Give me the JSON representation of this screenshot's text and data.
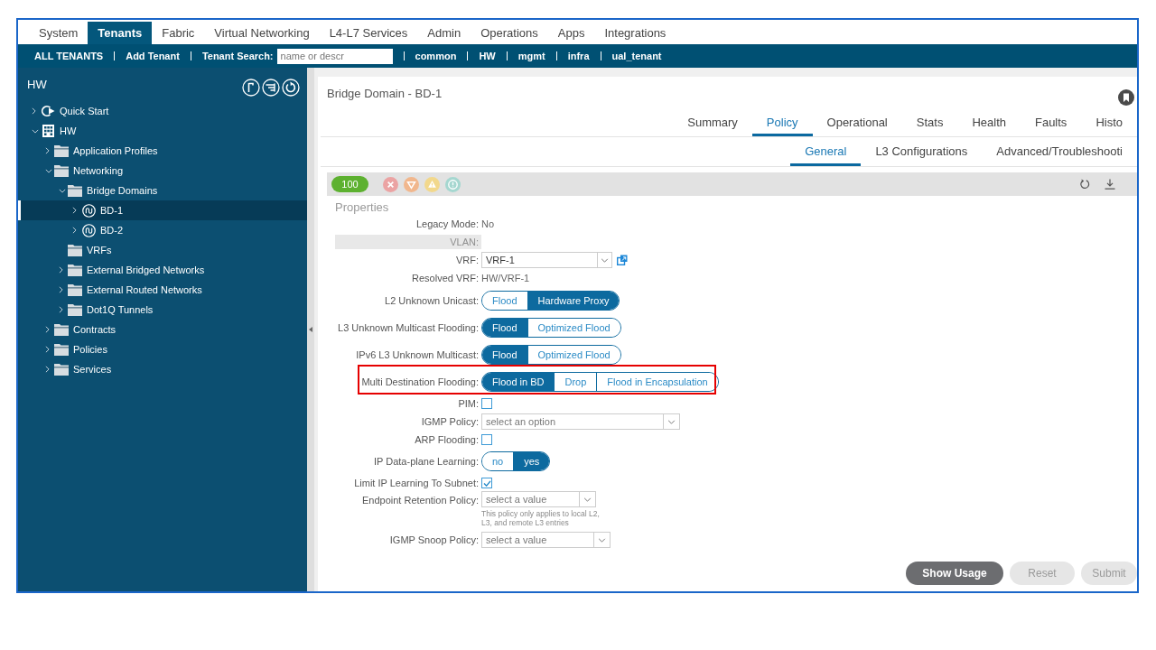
{
  "nav_tabs": [
    {
      "label": "System",
      "selected": false
    },
    {
      "label": "Tenants",
      "selected": true
    },
    {
      "label": "Fabric",
      "selected": false
    },
    {
      "label": "Virtual Networking",
      "selected": false
    },
    {
      "label": "L4-L7 Services",
      "selected": false
    },
    {
      "label": "Admin",
      "selected": false
    },
    {
      "label": "Operations",
      "selected": false
    },
    {
      "label": "Apps",
      "selected": false
    },
    {
      "label": "Integrations",
      "selected": false
    }
  ],
  "tenant_bar": {
    "actions": [
      "ALL TENANTS",
      "Add Tenant"
    ],
    "search": {
      "label": "Tenant Search:",
      "placeholder": "name or descr"
    },
    "tenants": [
      "common",
      "HW",
      "mgmt",
      "infra",
      "ual_tenant"
    ]
  },
  "sidebar": {
    "title": "HW",
    "tree": [
      {
        "label": "Quick Start",
        "kind": "quickstart",
        "expanded": false,
        "selected": false
      },
      {
        "label": "HW",
        "kind": "tenant",
        "expanded": true,
        "selected": false,
        "children": [
          {
            "label": "Application Profiles",
            "kind": "folder",
            "expanded": false,
            "selected": false
          },
          {
            "label": "Networking",
            "kind": "folder",
            "expanded": true,
            "selected": false,
            "children": [
              {
                "label": "Bridge Domains",
                "kind": "folder",
                "expanded": true,
                "selected": false,
                "children": [
                  {
                    "label": "BD-1",
                    "kind": "bridge",
                    "expanded": false,
                    "selected": true
                  },
                  {
                    "label": "BD-2",
                    "kind": "bridge",
                    "expanded": false,
                    "selected": false
                  }
                ]
              },
              {
                "label": "VRFs",
                "kind": "folder",
                "selected": false
              },
              {
                "label": "External Bridged Networks",
                "kind": "folder",
                "expanded": false,
                "selected": false
              },
              {
                "label": "External Routed Networks",
                "kind": "folder",
                "expanded": false,
                "selected": false
              },
              {
                "label": "Dot1Q Tunnels",
                "kind": "folder",
                "expanded": false,
                "selected": false
              }
            ]
          },
          {
            "label": "Contracts",
            "kind": "folder",
            "expanded": false,
            "selected": false
          },
          {
            "label": "Policies",
            "kind": "folder",
            "expanded": false,
            "selected": false
          },
          {
            "label": "Services",
            "kind": "folder",
            "expanded": false,
            "selected": false
          }
        ]
      }
    ]
  },
  "panel": {
    "title": "Bridge Domain - BD-1",
    "tabs": [
      {
        "label": "Summary",
        "selected": false
      },
      {
        "label": "Policy",
        "selected": true
      },
      {
        "label": "Operational",
        "selected": false
      },
      {
        "label": "Stats",
        "selected": false
      },
      {
        "label": "Health",
        "selected": false
      },
      {
        "label": "Faults",
        "selected": false
      },
      {
        "label": "Histo",
        "selected": false
      }
    ],
    "subtabs": [
      {
        "label": "General",
        "selected": true
      },
      {
        "label": "L3 Configurations",
        "selected": false
      },
      {
        "label": "Advanced/Troubleshooti",
        "selected": false
      }
    ],
    "health_score": "100"
  },
  "properties": {
    "title": "Properties",
    "fields": [
      {
        "kind": "text",
        "label": "Legacy Mode:",
        "value": "No",
        "disabled": false,
        "highlighted": false
      },
      {
        "kind": "text",
        "label": "VLAN:",
        "disabled": true,
        "highlighted": false
      },
      {
        "kind": "combo",
        "label": "VRF:",
        "value": "VRF-1",
        "disabled": false,
        "highlighted": false
      },
      {
        "kind": "text",
        "label": "Resolved VRF:",
        "value": "HW/VRF-1",
        "disabled": false,
        "highlighted": false
      },
      {
        "kind": "segmented",
        "label": "L2 Unknown Unicast:",
        "options": [
          {
            "label": "Flood",
            "selected": false
          },
          {
            "label": "Hardware Proxy",
            "selected": true
          }
        ],
        "disabled": false,
        "highlighted": false
      },
      {
        "kind": "segmented",
        "label": "L3 Unknown Multicast Flooding:",
        "options": [
          {
            "label": "Flood",
            "selected": true
          },
          {
            "label": "Optimized Flood",
            "selected": false
          }
        ],
        "disabled": false,
        "highlighted": false
      },
      {
        "kind": "segmented",
        "label": "IPv6 L3 Unknown Multicast:",
        "options": [
          {
            "label": "Flood",
            "selected": true
          },
          {
            "label": "Optimized Flood",
            "selected": false
          }
        ],
        "disabled": false,
        "highlighted": false
      },
      {
        "kind": "segmented",
        "label": "Multi Destination Flooding:",
        "options": [
          {
            "label": "Flood in BD",
            "selected": true
          },
          {
            "label": "Drop",
            "selected": false
          },
          {
            "label": "Flood in Encapsulation",
            "selected": false
          }
        ],
        "disabled": false,
        "highlighted": true
      },
      {
        "kind": "checkbox",
        "label": "PIM:",
        "checked": false,
        "disabled": false,
        "highlighted": false
      },
      {
        "kind": "select",
        "label": "IGMP Policy:",
        "placeholder": "select an option",
        "disabled": false,
        "highlighted": false
      },
      {
        "kind": "checkbox",
        "label": "ARP Flooding:",
        "checked": false,
        "disabled": false,
        "highlighted": false
      },
      {
        "kind": "segmented",
        "label": "IP Data-plane Learning:",
        "options": [
          {
            "label": "no",
            "selected": false
          },
          {
            "label": "yes",
            "selected": true
          }
        ],
        "disabled": false,
        "highlighted": false
      },
      {
        "kind": "checkbox",
        "label": "Limit IP Learning To Subnet:",
        "checked": true,
        "disabled": false,
        "highlighted": false
      },
      {
        "kind": "select",
        "label": "Endpoint Retention Policy:",
        "placeholder": "select a value",
        "hint": "This policy only applies to local L2, L3, and remote L3 entries",
        "disabled": false,
        "highlighted": false
      },
      {
        "kind": "select",
        "label": "IGMP Snoop Policy:",
        "placeholder": "select a value",
        "disabled": false,
        "highlighted": false
      }
    ]
  },
  "buttons": [
    {
      "label": "Show Usage",
      "disabled": false
    },
    {
      "label": "Reset",
      "disabled": true
    },
    {
      "label": "Submit",
      "disabled": true
    }
  ]
}
